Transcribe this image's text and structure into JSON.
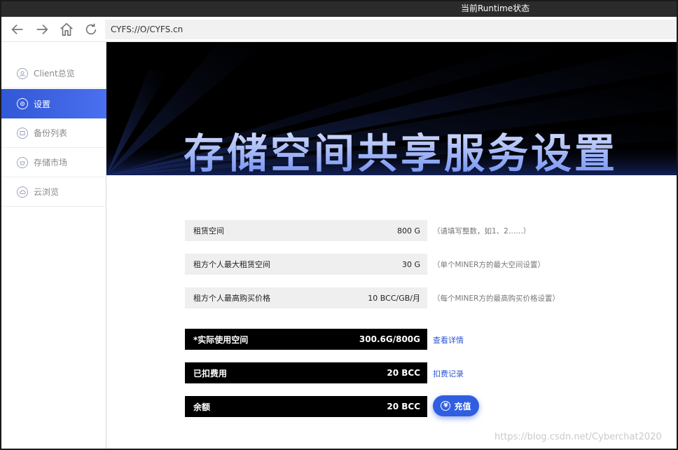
{
  "runtime": {
    "title": "当前Runtime状态"
  },
  "browser": {
    "address": "CYFS://O/CYFS.cn"
  },
  "sidebar": {
    "items": [
      {
        "label": "Client总览",
        "icon": "client-overview-icon",
        "active": false
      },
      {
        "label": "设置",
        "icon": "settings-icon",
        "active": true
      },
      {
        "label": "备份列表",
        "icon": "backup-icon",
        "active": false
      },
      {
        "label": "存储市场",
        "icon": "market-icon",
        "active": false
      },
      {
        "label": "云浏览",
        "icon": "cloud-browse-icon",
        "active": false
      }
    ]
  },
  "banner": {
    "title": "存储空间共享服务设置"
  },
  "form": {
    "rent_space": {
      "label": "租赁空间",
      "value": "800  G",
      "hint": "（请填写整数，如1、2……）"
    },
    "max_rent_space": {
      "label": "租方个人最大租赁空间",
      "value": "30  G",
      "hint": "（单个MINER方的最大空间设置）"
    },
    "max_price": {
      "label": "租方个人最高购买价格",
      "value": "10  BCC/GB/月",
      "hint": "（每个MINER方的最高购买价格设置）"
    }
  },
  "status": {
    "used_space": {
      "label": "*实际使用空间",
      "value": "300.6G/800G",
      "link": "查看详情"
    },
    "deducted": {
      "label": "已扣费用",
      "value": "20  BCC",
      "link": "扣费记录"
    },
    "balance": {
      "label": "余额",
      "value": "20  BCC",
      "button": "充值"
    }
  },
  "colors": {
    "accent": "#2f5ee0",
    "sidebar_active": "#3158d6",
    "banner_bg": "#000000"
  },
  "watermark": "https://blog.csdn.net/Cyberchat2020"
}
